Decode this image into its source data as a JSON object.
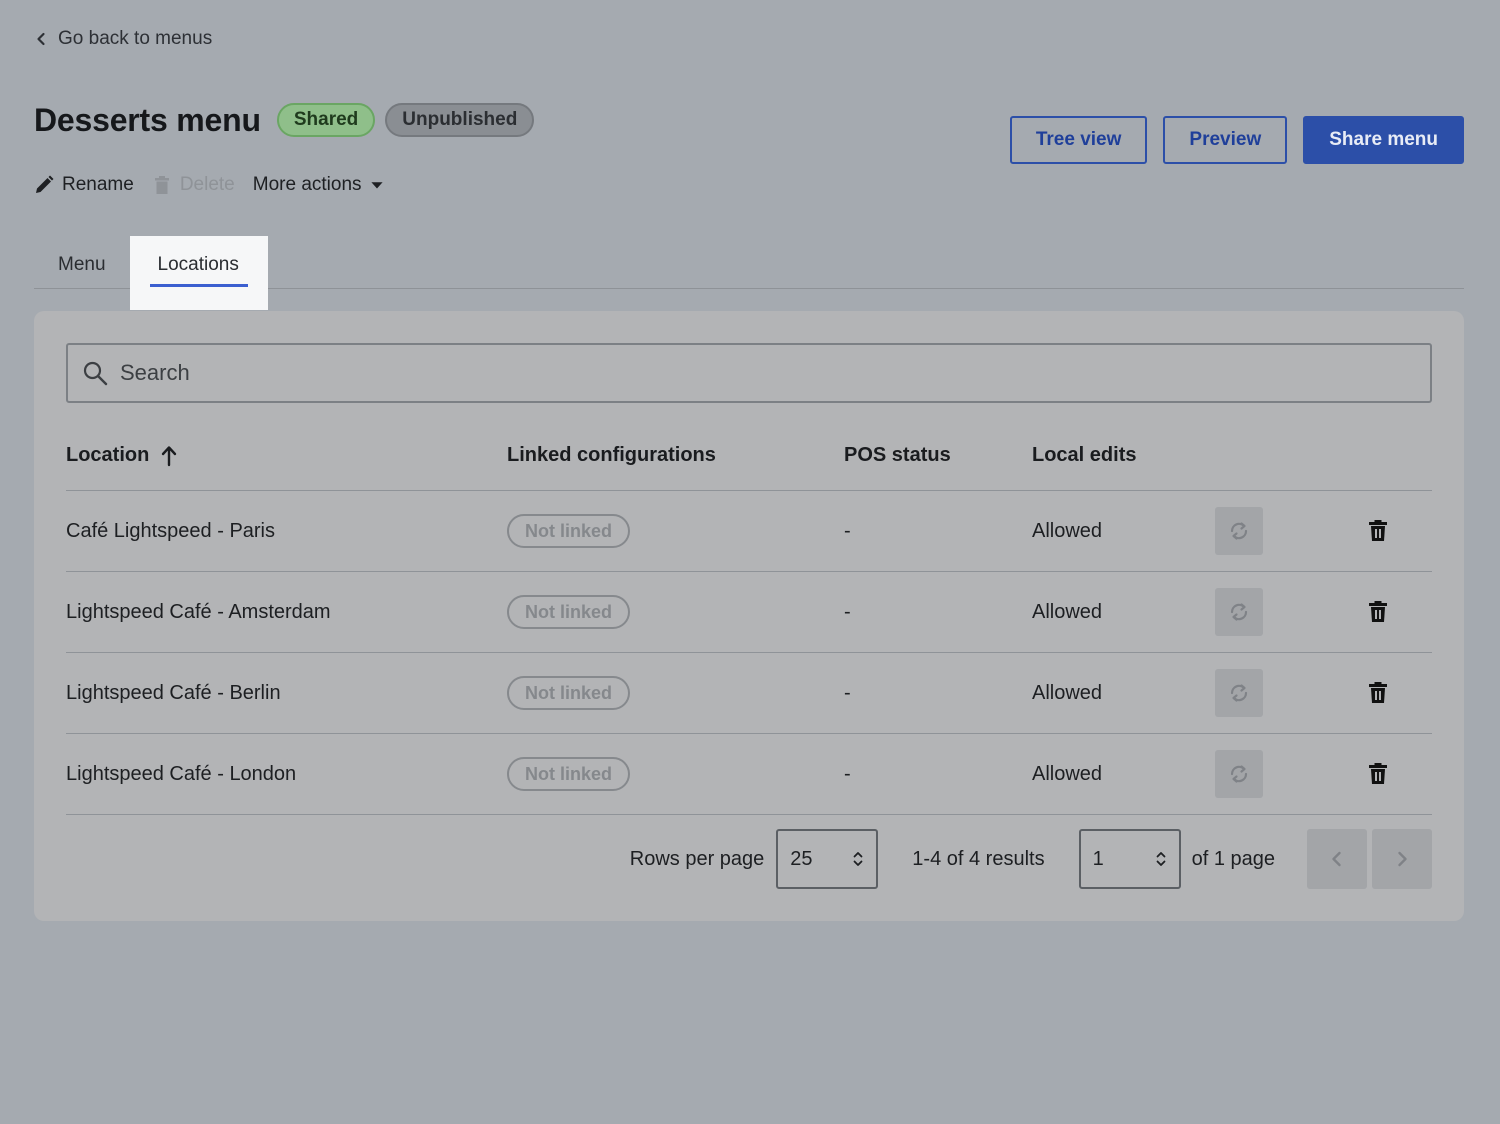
{
  "back_link": {
    "label": "Go back to menus"
  },
  "header": {
    "title": "Desserts menu",
    "badges": {
      "shared": "Shared",
      "unpublished": "Unpublished"
    },
    "actions": {
      "rename": "Rename",
      "delete": "Delete",
      "more_actions": "More actions"
    },
    "buttons": {
      "tree_view": "Tree view",
      "preview": "Preview",
      "share_menu": "Share menu"
    }
  },
  "tabs": [
    {
      "label": "Menu",
      "active": false
    },
    {
      "label": "Locations",
      "active": true
    }
  ],
  "search": {
    "placeholder": "Search",
    "value": ""
  },
  "table": {
    "columns": {
      "location": "Location",
      "linked_configurations": "Linked configurations",
      "pos_status": "POS status",
      "local_edits": "Local edits"
    },
    "sort": {
      "column": "location",
      "direction": "ascending",
      "icon": "arrow-up-icon"
    },
    "rows": [
      {
        "location": "Café Lightspeed - Paris",
        "linked": "Not linked",
        "pos_status": "-",
        "local_edits": "Allowed"
      },
      {
        "location": "Lightspeed Café - Amsterdam",
        "linked": "Not linked",
        "pos_status": "-",
        "local_edits": "Allowed"
      },
      {
        "location": "Lightspeed Café - Berlin",
        "linked": "Not linked",
        "pos_status": "-",
        "local_edits": "Allowed"
      },
      {
        "location": "Lightspeed Café - London",
        "linked": "Not linked",
        "pos_status": "-",
        "local_edits": "Allowed"
      }
    ]
  },
  "pagination": {
    "rows_per_page_label": "Rows per page",
    "rows_per_page": "25",
    "results": "1-4 of 4 results",
    "page": "1",
    "of_pages": "of 1 page"
  },
  "colors": {
    "primary": "#2c4fa8",
    "tab_underline": "#3b5fd0",
    "shared_badge": "#8fbf8a",
    "unpublished_badge": "#8a8e93"
  }
}
